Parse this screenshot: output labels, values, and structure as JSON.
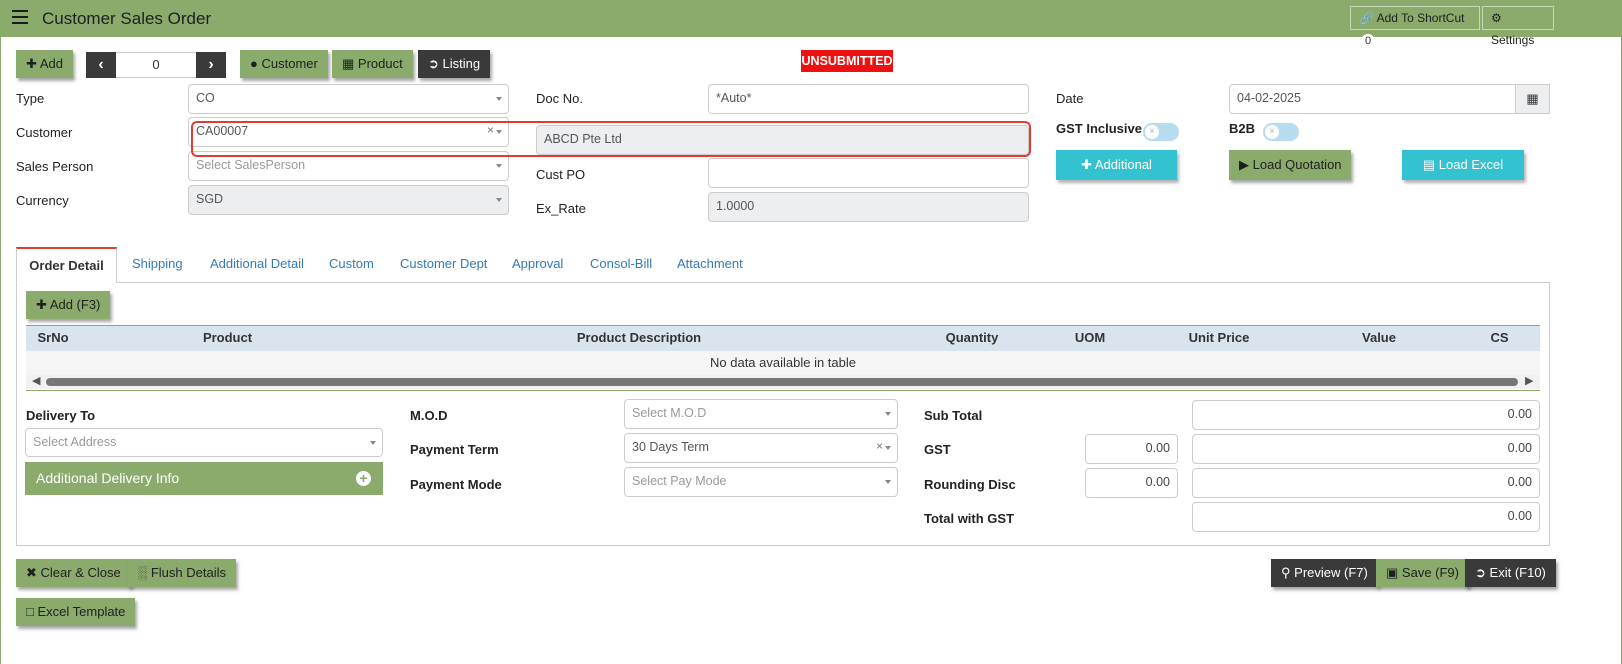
{
  "header": {
    "title": "Customer Sales Order",
    "shortcut_label": "Add To ShortCut",
    "shortcut_count": "0",
    "settings_label": "Settings"
  },
  "toolbar": {
    "add_label": "Add",
    "record_index": "0",
    "customer_label": "Customer",
    "product_label": "Product",
    "listing_label": "Listing"
  },
  "status": {
    "text": "UNSUBMITTED",
    "color": "#ee1111"
  },
  "form": {
    "type_label": "Type",
    "type_value": "CO",
    "customer_label": "Customer",
    "customer_code": "CA00007",
    "customer_name": "ABCD Pte Ltd",
    "sales_person_label": "Sales Person",
    "sales_person_placeholder": "Select SalesPerson",
    "currency_label": "Currency",
    "currency_value": "SGD",
    "doc_no_label": "Doc No.",
    "doc_no_value": "*Auto*",
    "cust_po_label": "Cust PO",
    "cust_po_value": "",
    "ex_rate_label": "Ex_Rate",
    "ex_rate_value": "1.0000",
    "date_label": "Date",
    "date_value": "04-02-2025",
    "gst_inclusive_label": "GST Inclusive",
    "b2b_label": "B2B",
    "additional_label": "Additional",
    "load_quotation_label": "Load Quotation",
    "load_excel_label": "Load Excel"
  },
  "tabs": [
    {
      "label": "Order Detail",
      "active": true
    },
    {
      "label": "Shipping"
    },
    {
      "label": "Additional Detail"
    },
    {
      "label": "Custom"
    },
    {
      "label": "Customer Dept"
    },
    {
      "label": "Approval"
    },
    {
      "label": "Consol-Bill"
    },
    {
      "label": "Attachment"
    }
  ],
  "detail": {
    "add_label": "Add (F3)",
    "columns": [
      "SrNo",
      "Product",
      "Product Description",
      "Quantity",
      "UOM",
      "Unit Price",
      "Value",
      "CS"
    ],
    "empty_text": "No data available in table"
  },
  "footer_form": {
    "delivery_to_label": "Delivery To",
    "address_placeholder": "Select Address",
    "additional_delivery_label": "Additional Delivery Info",
    "mod_label": "M.O.D",
    "mod_placeholder": "Select M.O.D",
    "payment_term_label": "Payment Term",
    "payment_term_value": "30 Days Term",
    "payment_mode_label": "Payment Mode",
    "payment_mode_placeholder": "Select Pay Mode",
    "sub_total_label": "Sub Total",
    "sub_total_value": "0.00",
    "gst_label": "GST",
    "gst_rate_value": "0.00",
    "gst_value": "0.00",
    "rounding_label": "Rounding Disc",
    "rounding_input_value": "0.00",
    "rounding_value": "0.00",
    "total_label": "Total with GST",
    "total_value": "0.00"
  },
  "actions": {
    "clear_close_label": "Clear & Close",
    "flush_label": "Flush Details",
    "excel_template_label": "Excel Template",
    "preview_label": "Preview (F7)",
    "save_label": "Save (F9)",
    "exit_label": "Exit (F10)"
  },
  "colors": {
    "header_green": "#8aab6c",
    "accent_cyan": "#33c3d0",
    "highlight_red": "#e53935"
  }
}
